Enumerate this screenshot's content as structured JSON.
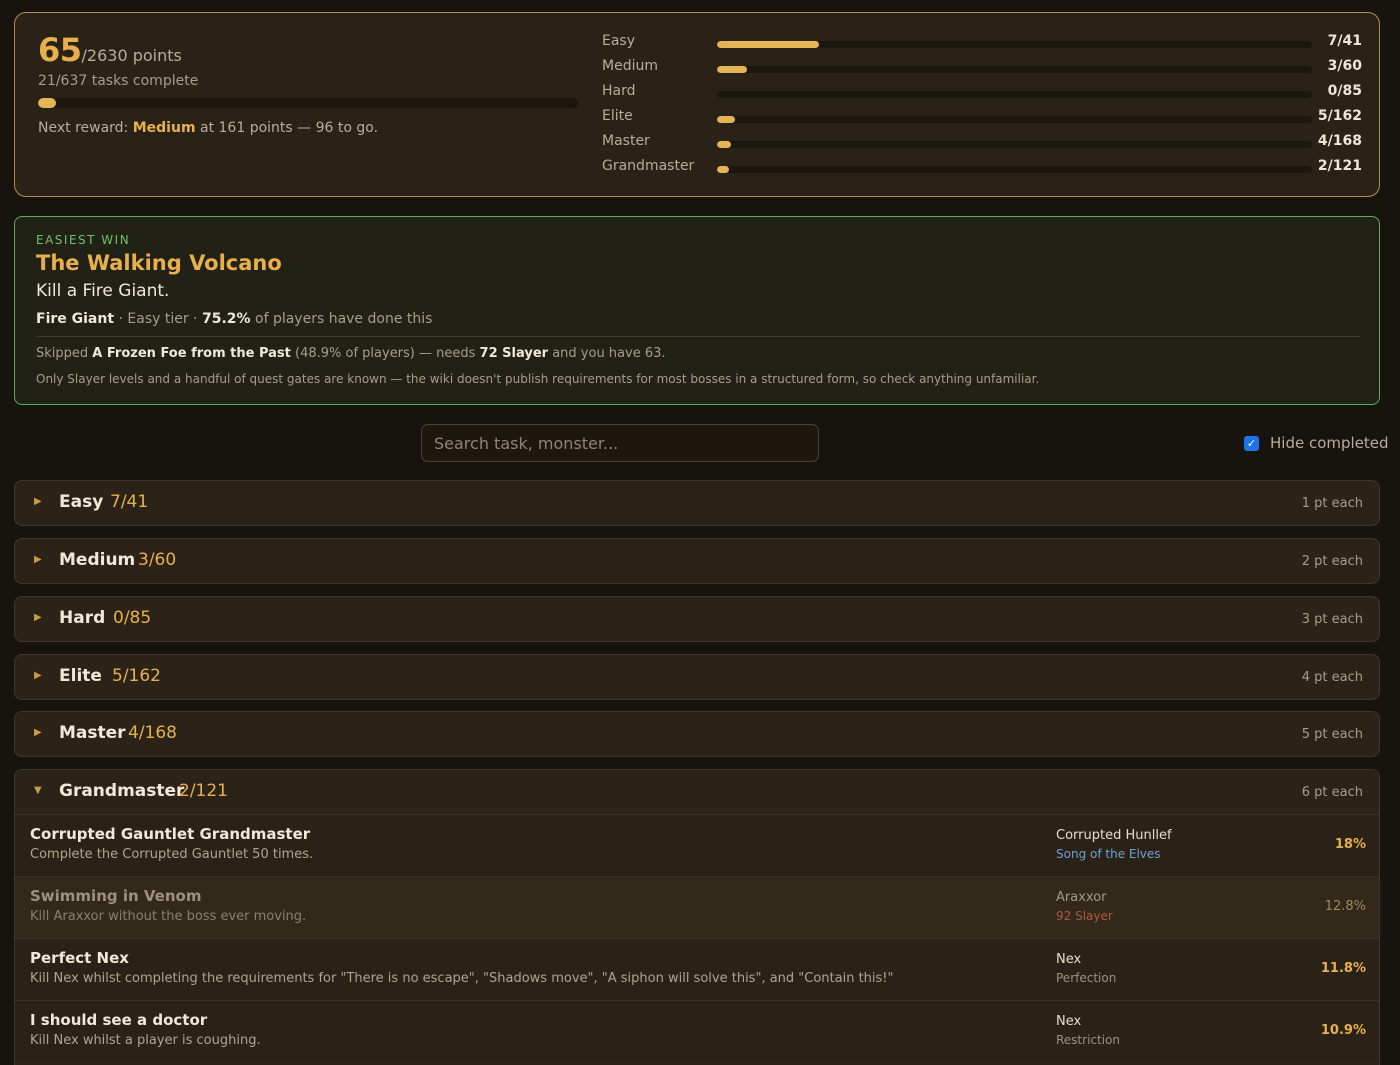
{
  "summary": {
    "points": "65",
    "points_total": "/2630 points",
    "tasks_complete": "21/637 tasks complete",
    "overall_progress": 0.033,
    "next_reward_prefix": "Next reward:",
    "next_reward_tier": "Medium",
    "next_reward_suffix": "at 161 points — 96 to go.",
    "tiers": [
      {
        "name": "Easy",
        "count": "7/41",
        "progress": 0.171
      },
      {
        "name": "Medium",
        "count": "3/60",
        "progress": 0.05
      },
      {
        "name": "Hard",
        "count": "0/85",
        "progress": 0
      },
      {
        "name": "Elite",
        "count": "5/162",
        "progress": 0.031
      },
      {
        "name": "Master",
        "count": "4/168",
        "progress": 0.024
      },
      {
        "name": "Grandmaster",
        "count": "2/121",
        "progress": 0.017
      }
    ]
  },
  "easiest_win": {
    "eyebrow": "EASIEST WIN",
    "title": "The Walking Volcano",
    "description": "Kill a Fire Giant.",
    "monster": "Fire Giant",
    "tier_text": "· Easy tier ·",
    "percent": "75.2%",
    "percent_suffix": "of players have done this",
    "skipped_prefix": "Skipped",
    "skipped_task": "A Frozen Foe from the Past",
    "skipped_percent": "(48.9% of players) — needs",
    "skipped_req": "72 Slayer",
    "skipped_suffix": "and you have 63.",
    "note": "Only Slayer levels and a handful of quest gates are known — the wiki doesn't publish requirements for most bosses in a structured form, so check anything unfamiliar."
  },
  "search": {
    "placeholder": "Search task, monster..."
  },
  "hide_completed": {
    "label": "Hide completed",
    "checked": true,
    "accent": "#1a73e8"
  },
  "sections": [
    {
      "name": "Easy",
      "count": "7/41",
      "points": "1 pt each",
      "expanded": false,
      "icon": "chevron-right-icon"
    },
    {
      "name": "Medium",
      "count": "3/60",
      "points": "2 pt each",
      "expanded": false,
      "icon": "chevron-right-icon"
    },
    {
      "name": "Hard",
      "count": "0/85",
      "points": "3 pt each",
      "expanded": false,
      "icon": "chevron-right-icon"
    },
    {
      "name": "Elite",
      "count": "5/162",
      "points": "4 pt each",
      "expanded": false,
      "icon": "chevron-right-icon"
    },
    {
      "name": "Master",
      "count": "4/168",
      "points": "5 pt each",
      "expanded": false,
      "icon": "chevron-right-icon"
    },
    {
      "name": "Grandmaster",
      "count": "2/121",
      "points": "6 pt each",
      "expanded": true,
      "icon": "chevron-down-icon"
    }
  ],
  "grandmaster_tasks": [
    {
      "title": "Corrupted Gauntlet Grandmaster",
      "description": "Complete the Corrupted Gauntlet 50 times.",
      "monster": "Corrupted Hunllef",
      "requirement": "Song of the Elves",
      "percent": "18%"
    },
    {
      "title": "Swimming in Venom",
      "description": "Kill Araxxor without the boss ever moving.",
      "monster": "Araxxor",
      "requirement": "92 Slayer",
      "percent": "12.8%"
    },
    {
      "title": "Perfect Nex",
      "description": "Kill Nex whilst completing the requirements for \"There is no escape\", \"Shadows move\", \"A siphon will solve this\", and \"Contain this!\"",
      "monster": "Nex",
      "requirement": "Perfection",
      "percent": "11.8%"
    },
    {
      "title": "I should see a doctor",
      "description": "Kill Nex whilst a player is coughing.",
      "monster": "Nex",
      "requirement": "Restriction",
      "percent": "10.9%"
    }
  ],
  "colors": {
    "accent": "#e8b04c",
    "success": "#5dab5a",
    "quest": "#6ea0d8",
    "unmet": "#b0583e",
    "background": "#17140f"
  }
}
